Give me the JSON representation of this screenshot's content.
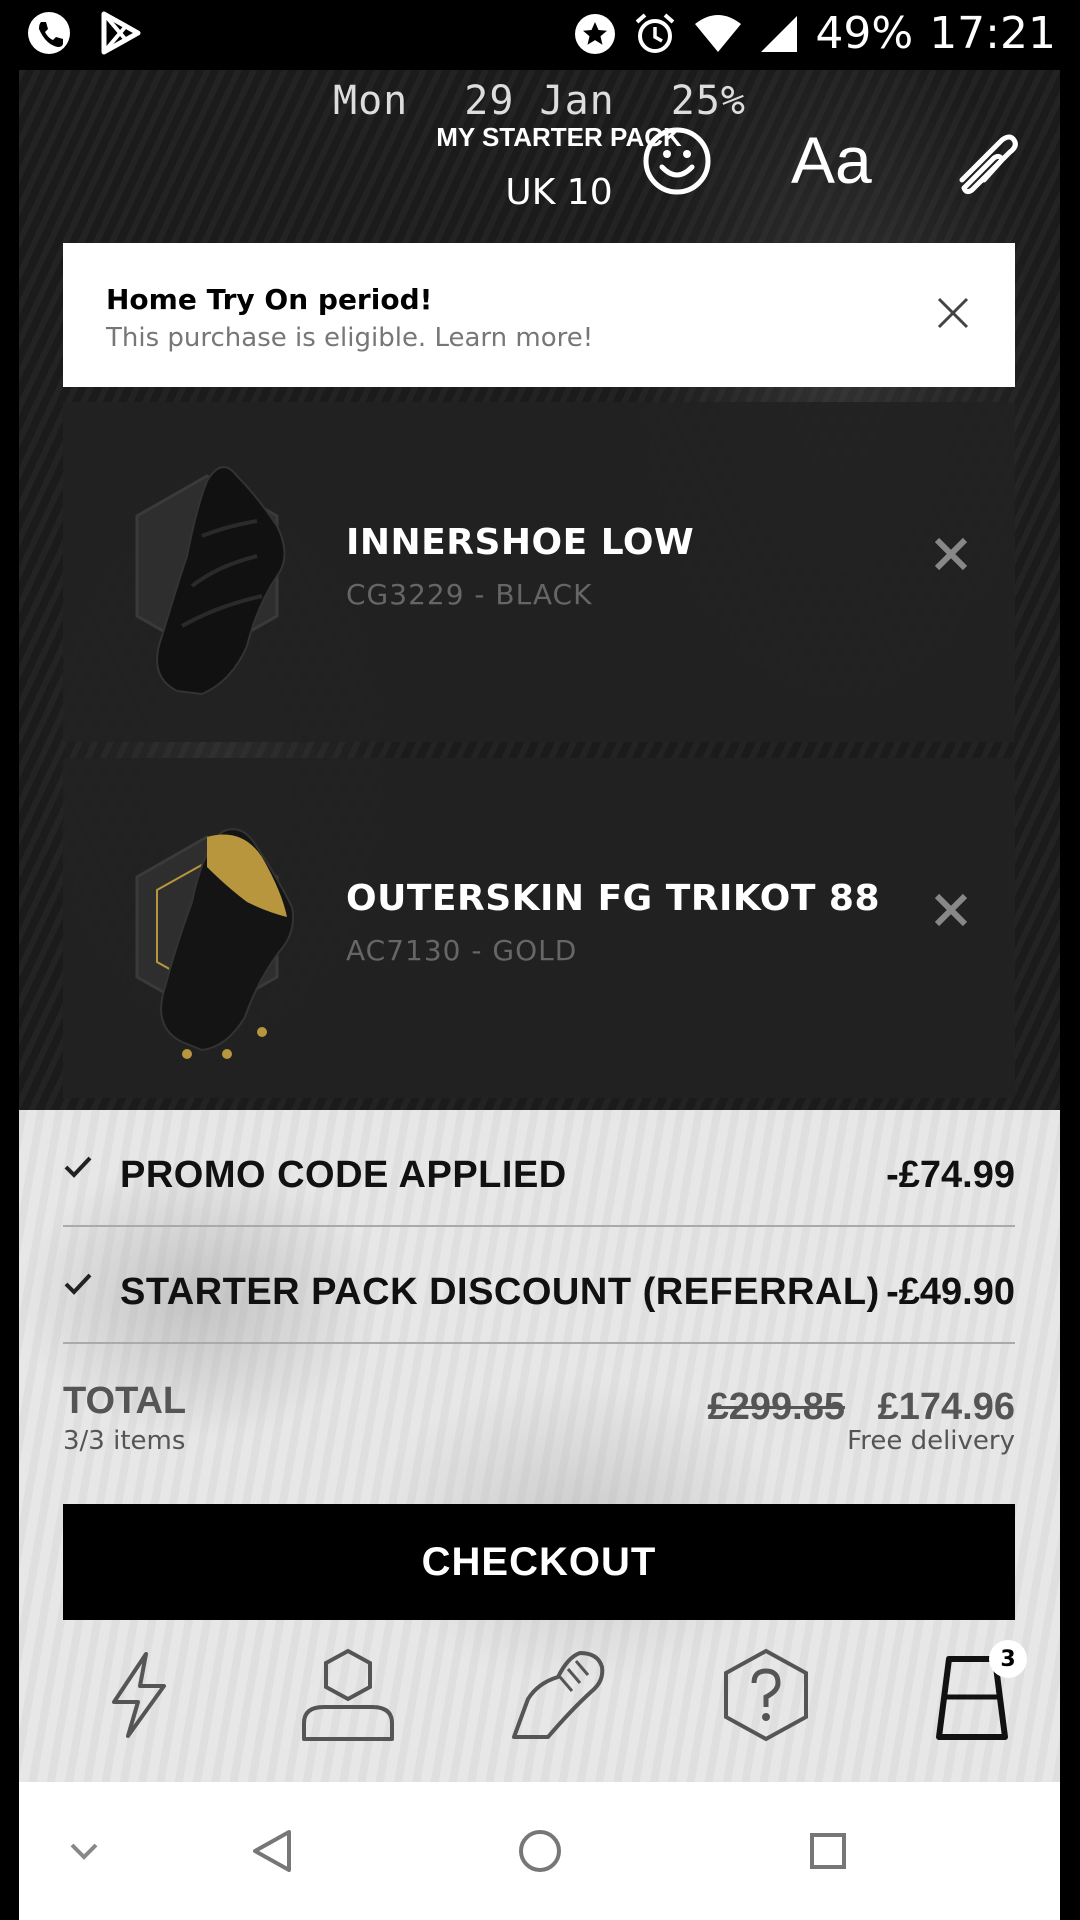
{
  "status_bar": {
    "battery": "49%",
    "time": "17:21"
  },
  "overlay": {
    "day": "Mon",
    "date": "29 Jan",
    "percent": "25%",
    "pack_title": "MY STARTER PACK",
    "size": "UK 10",
    "text_tool_label": "Aa"
  },
  "banner": {
    "title": "Home Try On period!",
    "text": "This purchase is eligible. Learn more!"
  },
  "products": [
    {
      "name": "INNERSHOE LOW",
      "code": "CG3229 - BLACK"
    },
    {
      "name": "OUTERSKIN FG TRIKOT 88",
      "code": "AC7130 - GOLD"
    }
  ],
  "discounts": [
    {
      "label": "PROMO CODE APPLIED",
      "amount": "-£74.99"
    },
    {
      "label": "STARTER PACK DISCOUNT (REFERRAL)",
      "amount": "-£49.90"
    }
  ],
  "total": {
    "label": "TOTAL",
    "items": "3/3 items",
    "original_price": "£299.85",
    "price": "£174.96",
    "delivery": "Free delivery"
  },
  "checkout_label": "CHECKOUT",
  "bottom_nav": {
    "items": [
      "lightning-icon",
      "profile-icon",
      "boot-icon",
      "help-icon",
      "bag-icon"
    ],
    "bag_badge": "3"
  },
  "colors": {
    "dark_panel": "#1c1c1c",
    "light_panel": "#e6e6e6",
    "accent_gold": "#b8963e",
    "checkout_bg": "#000000"
  }
}
